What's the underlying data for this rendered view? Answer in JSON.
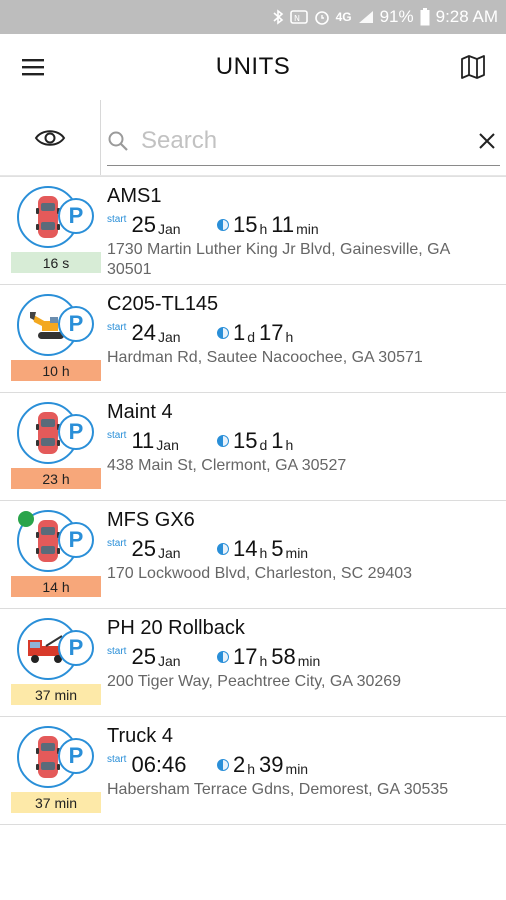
{
  "status_bar": {
    "battery": "91%",
    "time": "9:28 AM",
    "network": "4G"
  },
  "app_bar": {
    "title": "UNITS"
  },
  "search": {
    "placeholder": "Search",
    "value": ""
  },
  "units": [
    {
      "name": "AMS1",
      "start_label": "start",
      "start_big": "25",
      "start_small": "Jan",
      "dur1": "15",
      "u1": "h",
      "dur2": "11",
      "u2": "min",
      "address": "1730 Martin Luther King Jr Blvd, Gainesville, GA 30501",
      "age": "16 s",
      "age_color": "#d7ecd6",
      "icon": "car-icon",
      "key": false
    },
    {
      "name": "C205-TL145",
      "start_label": "start",
      "start_big": "24",
      "start_small": "Jan",
      "dur1": "1",
      "u1": "d",
      "dur2": "17",
      "u2": "h",
      "address": "Hardman Rd, Sautee Nacoochee, GA 30571",
      "age": "10 h",
      "age_color": "#f7a77a",
      "icon": "excavator-icon",
      "key": false
    },
    {
      "name": "Maint 4",
      "start_label": "start",
      "start_big": "11",
      "start_small": "Jan",
      "dur1": "15",
      "u1": "d",
      "dur2": "1",
      "u2": "h",
      "address": "438 Main St, Clermont, GA 30527",
      "age": "23 h",
      "age_color": "#f7a77a",
      "icon": "car-icon",
      "key": false
    },
    {
      "name": "MFS GX6",
      "start_label": "start",
      "start_big": "25",
      "start_small": "Jan",
      "dur1": "14",
      "u1": "h",
      "dur2": "5",
      "u2": "min",
      "address": "170 Lockwood Blvd, Charleston, SC 29403",
      "age": "14 h",
      "age_color": "#f7a77a",
      "icon": "car-icon",
      "key": true
    },
    {
      "name": "PH 20 Rollback",
      "start_label": "start",
      "start_big": "25",
      "start_small": "Jan",
      "dur1": "17",
      "u1": "h",
      "dur2": "58",
      "u2": "min",
      "address": "200 Tiger Way, Peachtree City, GA 30269",
      "age": "37 min",
      "age_color": "#fde9a8",
      "icon": "tow-truck-icon",
      "key": false
    },
    {
      "name": "Truck 4",
      "start_label": "start",
      "start_big": "06:46",
      "start_small": "",
      "dur1": "2",
      "u1": "h",
      "dur2": "39",
      "u2": "min",
      "address": "Habersham Terrace Gdns, Demorest, GA 30535",
      "age": "37 min",
      "age_color": "#fde9a8",
      "icon": "car-icon",
      "key": false
    }
  ],
  "colors": {
    "accent": "#2a8fd8",
    "status_bar": "#bdbdbd"
  }
}
